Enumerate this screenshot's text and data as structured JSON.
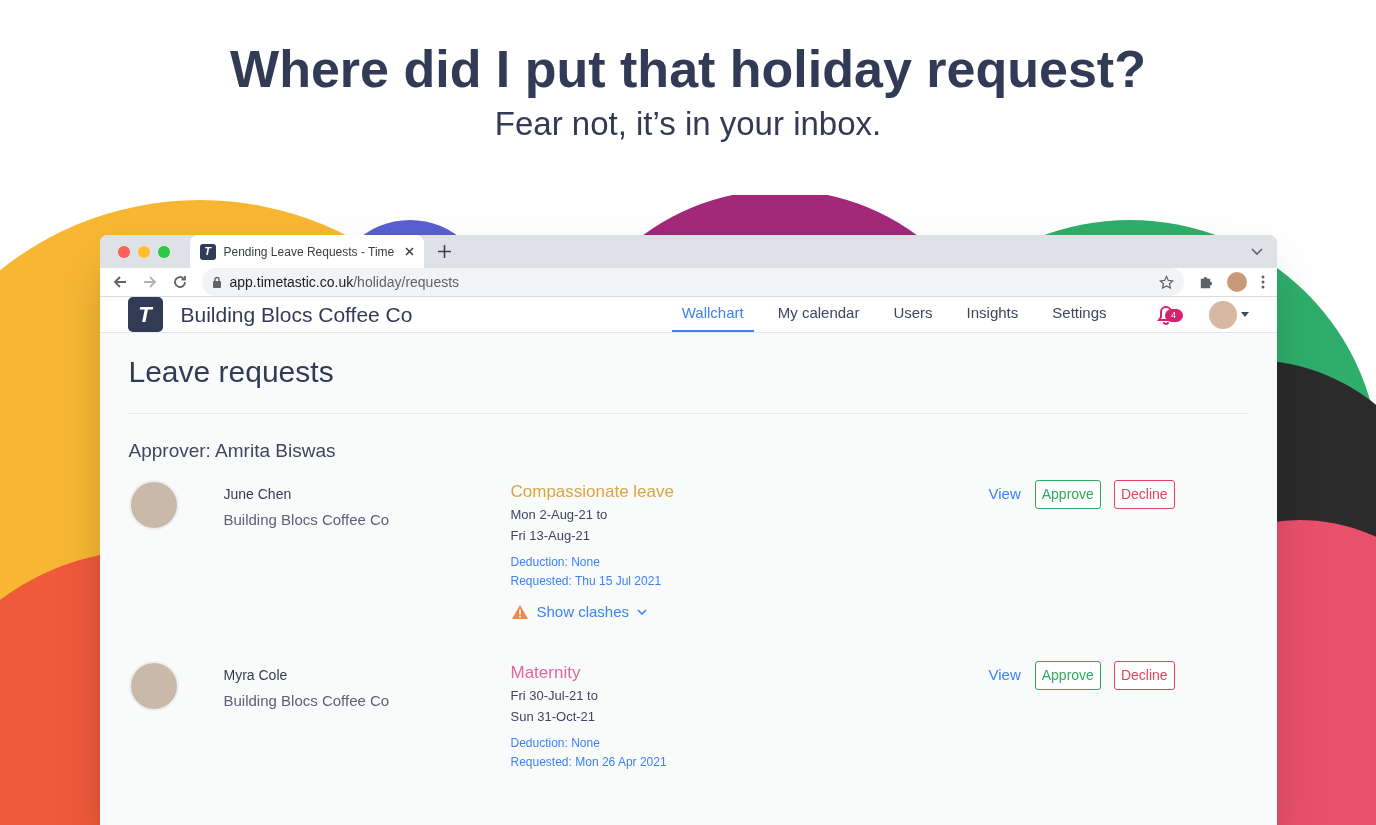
{
  "headline": {
    "title": "Where did I put that holiday request?",
    "subtitle": "Fear not, it’s in your inbox."
  },
  "browser": {
    "favicon": "T",
    "tab_title": "Pending Leave Requests - Time",
    "url_host": "app.timetastic.co.uk",
    "url_path": "/holiday/requests"
  },
  "app": {
    "logo": "T",
    "company": "Building Blocs Coffee Co",
    "nav": [
      {
        "label": "Wallchart",
        "selected": true
      },
      {
        "label": "My calendar",
        "selected": false
      },
      {
        "label": "Users",
        "selected": false
      },
      {
        "label": "Insights",
        "selected": false
      },
      {
        "label": "Settings",
        "selected": false
      }
    ],
    "notifications": "4"
  },
  "page": {
    "title": "Leave requests",
    "approver": "Approver: Amrita Biswas",
    "requests": [
      {
        "name": "June Chen",
        "company": "Building Blocs Coffee Co",
        "leave_type": "Compassionate leave",
        "color": "#d9a441",
        "dates": [
          "Mon 2-Aug-21 to",
          "Fri 13-Aug-21"
        ],
        "deduction": "Deduction: None",
        "requested": "Requested: Thu 15 Jul 2021",
        "clashes": "Show clashes",
        "actions": [
          "View",
          "Approve",
          "Decline"
        ]
      },
      {
        "name": "Myra Cole",
        "company": "Building Blocs Coffee Co",
        "leave_type": "Maternity",
        "color": "#e0679f",
        "dates": [
          "Fri 30-Jul-21 to",
          "Sun 31-Oct-21"
        ],
        "deduction": "Deduction: None",
        "requested": "Requested: Mon 26 Apr 2021",
        "actions": [
          "View",
          "Approve",
          "Decline"
        ]
      }
    ]
  }
}
